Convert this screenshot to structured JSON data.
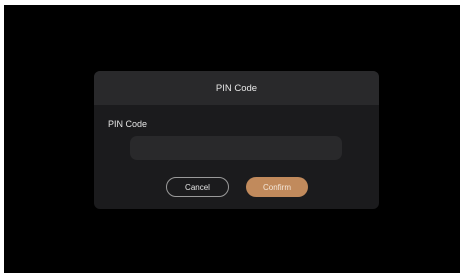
{
  "dialog": {
    "title": "PIN Code",
    "field_label": "PIN Code",
    "pin_value": "",
    "pin_placeholder": "",
    "cancel_label": "Cancel",
    "confirm_label": "Confirm"
  },
  "colors": {
    "background": "#000000",
    "dialog": "#1b1b1d",
    "header": "#29292b",
    "input": "#29292b",
    "confirm_accent": "#c18a5c"
  }
}
